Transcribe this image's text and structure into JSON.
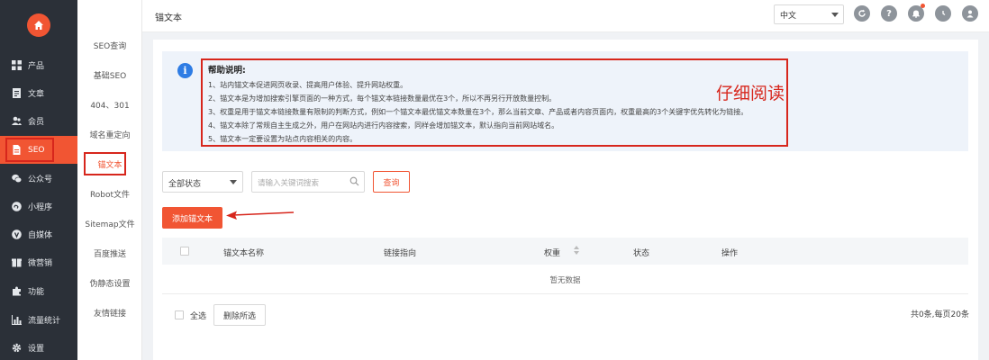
{
  "colors": {
    "accent": "#f15533",
    "annotation": "#d7261c",
    "sidebar_bg": "#2b3038",
    "info": "#2e7ce4"
  },
  "sidebar": {
    "items": [
      {
        "label": "产品",
        "icon": "grid-icon"
      },
      {
        "label": "文章",
        "icon": "document-icon"
      },
      {
        "label": "会员",
        "icon": "users-icon"
      },
      {
        "label": "SEO",
        "icon": "file-icon",
        "active": true
      },
      {
        "label": "公众号",
        "icon": "wechat-icon"
      },
      {
        "label": "小程序",
        "icon": "miniprogram-icon"
      },
      {
        "label": "自媒体",
        "icon": "media-icon"
      },
      {
        "label": "微营销",
        "icon": "marketing-icon"
      },
      {
        "label": "功能",
        "icon": "puzzle-icon"
      },
      {
        "label": "流量统计",
        "icon": "bar-chart-icon"
      },
      {
        "label": "设置",
        "icon": "gear-icon"
      }
    ]
  },
  "submenu": {
    "items": [
      {
        "label": "SEO查询"
      },
      {
        "label": "基础SEO"
      },
      {
        "label": "404、301"
      },
      {
        "label": "域名重定向"
      },
      {
        "label": "锚文本",
        "active": true
      },
      {
        "label": "Robot文件"
      },
      {
        "label": "Sitemap文件"
      },
      {
        "label": "百度推送"
      },
      {
        "label": "伪静态设置"
      },
      {
        "label": "友情链接"
      }
    ]
  },
  "header": {
    "title": "锚文本",
    "language": "中文"
  },
  "help": {
    "title": "帮助说明:",
    "lines": [
      "1、站内锚文本促进网页收录、提高用户体验、提升网站权重。",
      "2、锚文本是为增加搜索引擎页面的一种方式，每个锚文本链接数量最优在3个，所以不再另行开放数量控制。",
      "3、权重是用于锚文本链接数量有限制的判断方式，例如一个锚文本最优锚文本数量在3个，那么当前文章、产品或者内容页面内，权重最高的3个关键字优先转化为链接。",
      "4、锚文本除了常规自主生成之外，用户在网站内进行内容搜索，同样会增加锚文本，默认指向当前网站域名。",
      "5、锚文本一定要设置为站点内容相关的内容。"
    ],
    "annotation": "仔细阅读"
  },
  "filters": {
    "status": "全部状态",
    "search_placeholder": "请输入关键词搜索",
    "query_label": "查询"
  },
  "add_button": "添加锚文本",
  "table": {
    "columns": [
      "锚文本名称",
      "链接指向",
      "权重",
      "状态",
      "操作"
    ],
    "empty_text": "暂无数据"
  },
  "footer": {
    "select_all": "全选",
    "delete_selected": "删除所选",
    "pagination": "共0条,每页20条"
  }
}
